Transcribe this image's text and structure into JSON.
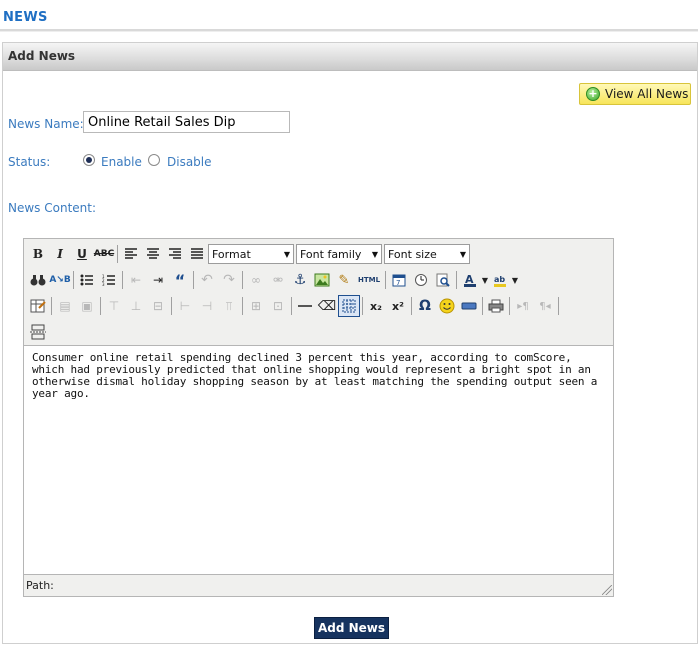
{
  "page": {
    "title": "NEWS"
  },
  "panel": {
    "title": "Add News"
  },
  "view_all": {
    "label": "View All News"
  },
  "form": {
    "name_label": "News Name:",
    "name_value": "Online Retail Sales Dip",
    "status_label": "Status:",
    "status_options": [
      "Enable",
      "Disable"
    ],
    "status_selected": "Enable",
    "content_label": "News Content:"
  },
  "editor": {
    "dropdowns": {
      "format": "Format",
      "font_family": "Font family",
      "font_size": "Font size"
    },
    "content": "Consumer online retail spending declined 3 percent this year, according to comScore, which had previously predicted that online shopping would represent a bright spot in an otherwise dismal holiday shopping season by at least matching the spending output seen a year ago.",
    "status": "Path:"
  },
  "submit": {
    "label": "Add News"
  },
  "colors": {
    "title": "#1f6fc3",
    "label": "#3b7bbf",
    "submit_bg": "#16335f",
    "view_all_bg": "#f7e55a"
  }
}
